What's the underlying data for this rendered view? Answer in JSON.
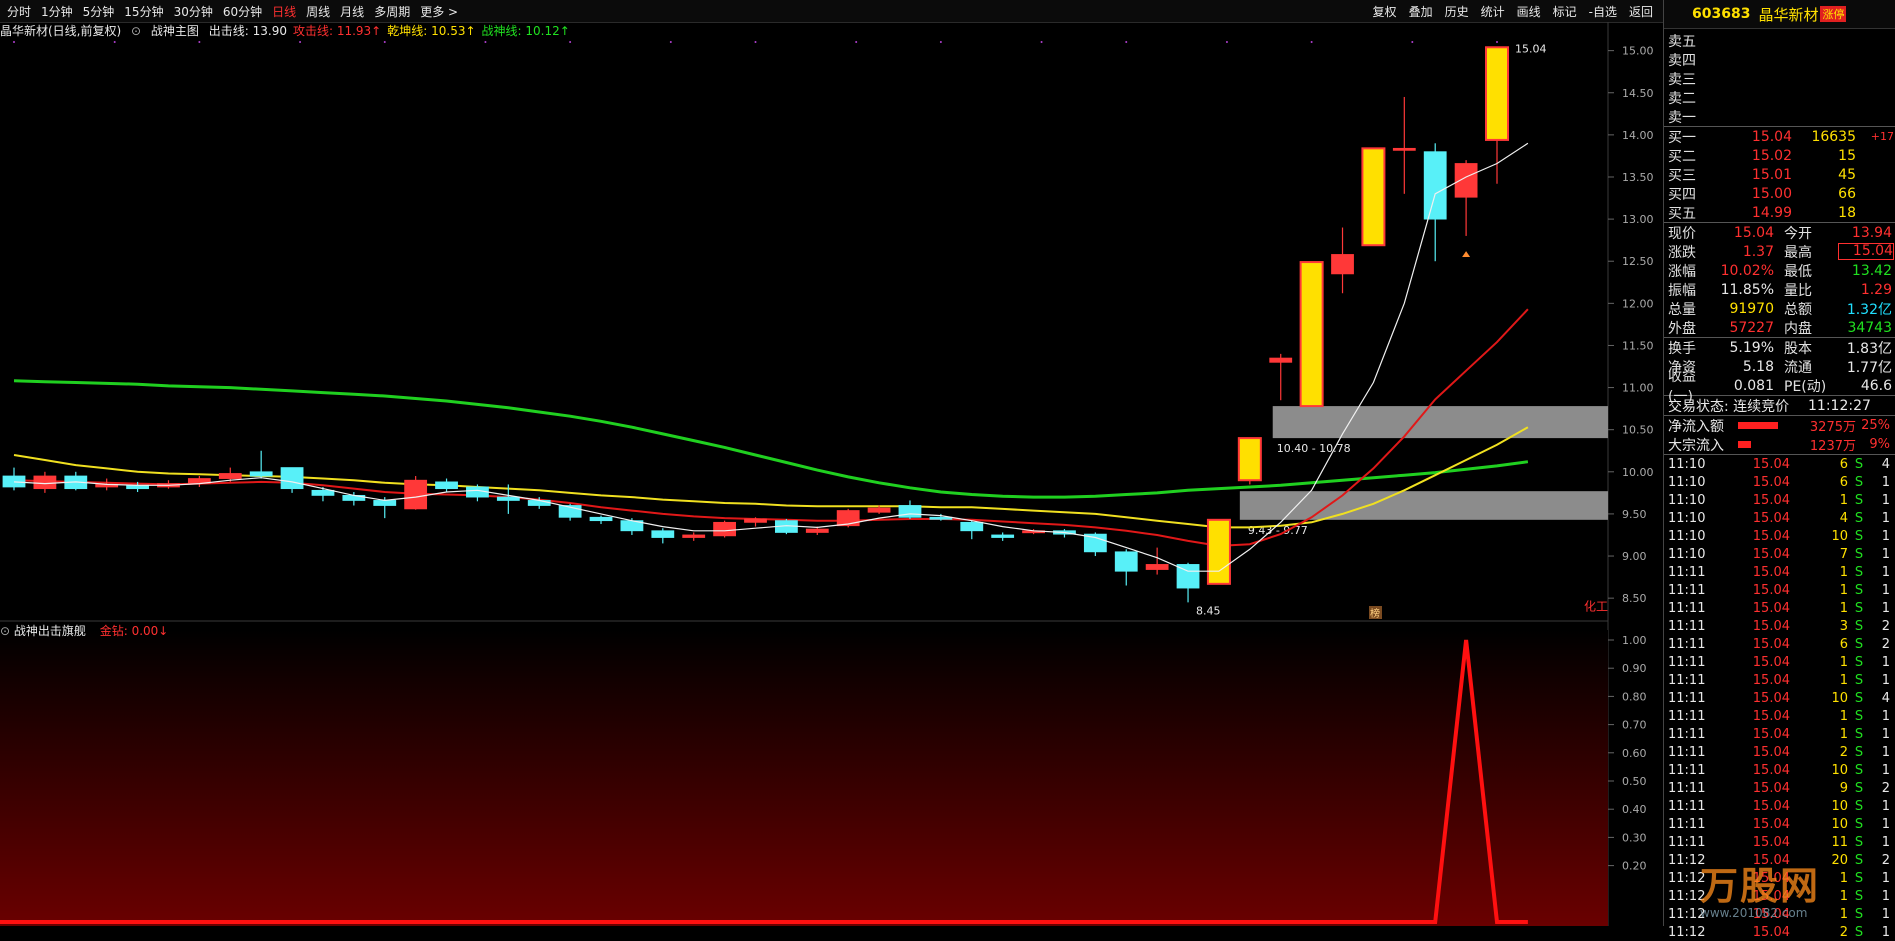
{
  "tabs": [
    "分时",
    "1分钟",
    "5分钟",
    "15分钟",
    "30分钟",
    "60分钟",
    "日线",
    "周线",
    "月线",
    "多周期",
    "更多 >"
  ],
  "active_tab": "日线",
  "toolbar": [
    "复权",
    "叠加",
    "历史",
    "统计",
    "画线",
    "标记",
    "-自选",
    "返回"
  ],
  "main_indicator": {
    "stock_label": "晶华新材(日线,前复权)",
    "indicator_name": "战神主图",
    "items": [
      {
        "label": "出击线: 13.90",
        "color": "#e8e8e8"
      },
      {
        "label": "攻击线: 11.93↑",
        "color": "#ff3030"
      },
      {
        "label": "乾坤线: 10.53↑",
        "color": "#ffe000"
      },
      {
        "label": "战神线: 10.12↑",
        "color": "#20e020"
      }
    ]
  },
  "sub_indicator": {
    "name": "战神出击旗舰",
    "items": [
      {
        "label": "金钻: 0.00↓",
        "color": "#ff3030"
      }
    ]
  },
  "price_axis": [
    "15.00",
    "14.50",
    "14.00",
    "13.50",
    "13.00",
    "12.50",
    "12.00",
    "11.50",
    "11.00",
    "10.50",
    "10.00",
    "9.50",
    "9.00",
    "8.50"
  ],
  "sub_axis": [
    "1.00",
    "0.90",
    "0.80",
    "0.70",
    "0.60",
    "0.50",
    "0.40",
    "0.30",
    "0.20"
  ],
  "chart_labels": {
    "high_label": "15.04",
    "low_label": "8.45",
    "zone_upper": "10.40 - 10.78",
    "zone_lower": "9.43 - 9.77",
    "side_tag": "化工",
    "marker_tag": "榜"
  },
  "chart_data": {
    "type": "candlestick",
    "ylim": [
      8.3,
      15.15
    ],
    "candles": [
      {
        "o": 9.95,
        "c": 9.82,
        "h": 10.05,
        "l": 9.78
      },
      {
        "o": 9.8,
        "c": 9.95,
        "h": 10.0,
        "l": 9.75
      },
      {
        "o": 9.95,
        "c": 9.8,
        "h": 10.0,
        "l": 9.78
      },
      {
        "o": 9.82,
        "c": 9.85,
        "h": 9.92,
        "l": 9.78
      },
      {
        "o": 9.84,
        "c": 9.8,
        "h": 9.88,
        "l": 9.76
      },
      {
        "o": 9.82,
        "c": 9.86,
        "h": 9.9,
        "l": 9.8
      },
      {
        "o": 9.86,
        "c": 9.92,
        "h": 9.95,
        "l": 9.82
      },
      {
        "o": 9.92,
        "c": 9.98,
        "h": 10.05,
        "l": 9.88
      },
      {
        "o": 10.0,
        "c": 9.95,
        "h": 10.25,
        "l": 9.92
      },
      {
        "o": 10.05,
        "c": 9.8,
        "h": 10.05,
        "l": 9.75
      },
      {
        "o": 9.78,
        "c": 9.72,
        "h": 9.82,
        "l": 9.65
      },
      {
        "o": 9.72,
        "c": 9.66,
        "h": 9.76,
        "l": 9.6
      },
      {
        "o": 9.66,
        "c": 9.6,
        "h": 9.7,
        "l": 9.45
      },
      {
        "o": 9.56,
        "c": 9.9,
        "h": 9.95,
        "l": 9.55
      },
      {
        "o": 9.88,
        "c": 9.8,
        "h": 9.92,
        "l": 9.76
      },
      {
        "o": 9.82,
        "c": 9.7,
        "h": 9.85,
        "l": 9.65
      },
      {
        "o": 9.7,
        "c": 9.66,
        "h": 9.85,
        "l": 9.5
      },
      {
        "o": 9.66,
        "c": 9.6,
        "h": 9.7,
        "l": 9.56
      },
      {
        "o": 9.6,
        "c": 9.46,
        "h": 9.62,
        "l": 9.42
      },
      {
        "o": 9.46,
        "c": 9.42,
        "h": 9.48,
        "l": 9.38
      },
      {
        "o": 9.42,
        "c": 9.3,
        "h": 9.45,
        "l": 9.25
      },
      {
        "o": 9.3,
        "c": 9.22,
        "h": 9.33,
        "l": 9.15
      },
      {
        "o": 9.22,
        "c": 9.25,
        "h": 9.28,
        "l": 9.18
      },
      {
        "o": 9.24,
        "c": 9.4,
        "h": 9.42,
        "l": 9.22
      },
      {
        "o": 9.4,
        "c": 9.44,
        "h": 9.46,
        "l": 9.35
      },
      {
        "o": 9.42,
        "c": 9.28,
        "h": 9.44,
        "l": 9.26
      },
      {
        "o": 9.28,
        "c": 9.32,
        "h": 9.35,
        "l": 9.25
      },
      {
        "o": 9.36,
        "c": 9.54,
        "h": 9.56,
        "l": 9.34
      },
      {
        "o": 9.52,
        "c": 9.57,
        "h": 9.6,
        "l": 9.5
      },
      {
        "o": 9.6,
        "c": 9.46,
        "h": 9.66,
        "l": 9.44
      },
      {
        "o": 9.46,
        "c": 9.44,
        "h": 9.5,
        "l": 9.42
      },
      {
        "o": 9.4,
        "c": 9.3,
        "h": 9.42,
        "l": 9.2
      },
      {
        "o": 9.25,
        "c": 9.22,
        "h": 9.28,
        "l": 9.18
      },
      {
        "o": 9.28,
        "c": 9.3,
        "h": 9.32,
        "l": 9.26
      },
      {
        "o": 9.3,
        "c": 9.26,
        "h": 9.32,
        "l": 9.22
      },
      {
        "o": 9.26,
        "c": 9.05,
        "h": 9.28,
        "l": 9.0
      },
      {
        "o": 9.05,
        "c": 8.82,
        "h": 9.08,
        "l": 8.65
      },
      {
        "o": 8.84,
        "c": 8.9,
        "h": 9.1,
        "l": 8.78
      },
      {
        "o": 8.9,
        "c": 8.62,
        "h": 8.92,
        "l": 8.45
      },
      {
        "o": 8.67,
        "c": 9.43,
        "h": 9.43,
        "l": 8.67
      },
      {
        "o": 9.9,
        "c": 10.4,
        "h": 10.4,
        "l": 9.85
      },
      {
        "o": 11.3,
        "c": 11.35,
        "h": 11.4,
        "l": 10.85
      },
      {
        "o": 10.78,
        "c": 12.49,
        "h": 12.49,
        "l": 10.78
      },
      {
        "o": 12.35,
        "c": 12.58,
        "h": 12.9,
        "l": 12.12
      },
      {
        "o": 12.69,
        "c": 13.84,
        "h": 13.84,
        "l": 12.69
      },
      {
        "o": 13.84,
        "c": 13.84,
        "h": 14.45,
        "l": 13.3
      },
      {
        "o": 13.8,
        "c": 13.0,
        "h": 13.9,
        "l": 12.5
      },
      {
        "o": 13.26,
        "c": 13.66,
        "h": 13.7,
        "l": 12.8
      },
      {
        "o": 13.94,
        "c": 15.04,
        "h": 15.04,
        "l": 13.42
      }
    ],
    "ma_white": [
      9.88,
      9.86,
      9.88,
      9.85,
      9.84,
      9.84,
      9.86,
      9.9,
      9.93,
      9.88,
      9.8,
      9.72,
      9.66,
      9.7,
      9.76,
      9.78,
      9.72,
      9.66,
      9.58,
      9.5,
      9.42,
      9.35,
      9.3,
      9.3,
      9.33,
      9.36,
      9.34,
      9.38,
      9.45,
      9.5,
      9.48,
      9.42,
      9.35,
      9.3,
      9.28,
      9.22,
      9.1,
      8.98,
      8.82,
      8.82,
      9.08,
      9.4,
      9.78,
      10.45,
      11.06,
      12.0,
      13.3,
      13.5,
      13.66,
      13.9
    ],
    "ma_red": [
      9.9,
      9.89,
      9.88,
      9.87,
      9.86,
      9.85,
      9.86,
      9.87,
      9.88,
      9.87,
      9.84,
      9.8,
      9.76,
      9.74,
      9.73,
      9.72,
      9.7,
      9.67,
      9.63,
      9.58,
      9.54,
      9.5,
      9.47,
      9.45,
      9.44,
      9.43,
      9.42,
      9.42,
      9.43,
      9.44,
      9.44,
      9.43,
      9.41,
      9.39,
      9.37,
      9.34,
      9.3,
      9.25,
      9.18,
      9.12,
      9.14,
      9.26,
      9.46,
      9.72,
      10.04,
      10.42,
      10.86,
      11.2,
      11.54,
      11.93
    ],
    "ma_yellow": [
      10.2,
      10.14,
      10.08,
      10.04,
      10.0,
      9.98,
      9.97,
      9.96,
      9.95,
      9.94,
      9.92,
      9.9,
      9.87,
      9.85,
      9.84,
      9.82,
      9.8,
      9.78,
      9.75,
      9.72,
      9.7,
      9.67,
      9.65,
      9.63,
      9.62,
      9.6,
      9.59,
      9.59,
      9.59,
      9.59,
      9.58,
      9.58,
      9.56,
      9.54,
      9.52,
      9.5,
      9.46,
      9.42,
      9.38,
      9.34,
      9.34,
      9.36,
      9.4,
      9.5,
      9.62,
      9.78,
      9.96,
      10.14,
      10.32,
      10.53
    ],
    "ma_green": [
      11.08,
      11.07,
      11.06,
      11.05,
      11.04,
      11.02,
      11.01,
      11.0,
      10.98,
      10.96,
      10.94,
      10.92,
      10.9,
      10.87,
      10.84,
      10.8,
      10.76,
      10.71,
      10.66,
      10.6,
      10.53,
      10.45,
      10.37,
      10.29,
      10.2,
      10.11,
      10.02,
      9.94,
      9.87,
      9.81,
      9.76,
      9.73,
      9.71,
      9.7,
      9.7,
      9.71,
      9.73,
      9.75,
      9.78,
      9.8,
      9.82,
      9.84,
      9.87,
      9.9,
      9.93,
      9.96,
      9.99,
      10.03,
      10.07,
      10.12
    ],
    "zones": [
      {
        "low": 10.4,
        "high": 10.78
      },
      {
        "low": 9.43,
        "high": 9.77
      }
    ],
    "sub_signal": [
      0,
      0,
      0,
      0,
      0,
      0,
      0,
      0,
      0,
      0,
      0,
      0,
      0,
      0,
      0,
      0,
      0,
      0,
      0,
      0,
      0,
      0,
      0,
      0,
      0,
      0,
      0,
      0,
      0,
      0,
      0,
      0,
      0,
      0,
      0,
      0,
      0,
      0,
      0,
      0,
      0,
      0,
      0,
      0,
      0,
      0,
      0,
      1,
      0,
      0
    ]
  },
  "quote": {
    "code": "603683",
    "name": "晶华新材",
    "badge": "涨停",
    "sells": [
      {
        "label": "卖五",
        "price": "",
        "vol": ""
      },
      {
        "label": "卖四",
        "price": "",
        "vol": ""
      },
      {
        "label": "卖三",
        "price": "",
        "vol": ""
      },
      {
        "label": "卖二",
        "price": "",
        "vol": ""
      },
      {
        "label": "卖一",
        "price": "",
        "vol": ""
      }
    ],
    "buys": [
      {
        "label": "买一",
        "price": "15.04",
        "vol": "16635",
        "chg": "+17"
      },
      {
        "label": "买二",
        "price": "15.02",
        "vol": "15",
        "chg": ""
      },
      {
        "label": "买三",
        "price": "15.01",
        "vol": "45",
        "chg": ""
      },
      {
        "label": "买四",
        "price": "15.00",
        "vol": "66",
        "chg": ""
      },
      {
        "label": "买五",
        "price": "14.99",
        "vol": "18",
        "chg": ""
      }
    ],
    "stats1": [
      {
        "l1": "现价",
        "v1": "15.04",
        "c1": "red",
        "l2": "今开",
        "v2": "13.94",
        "c2": "red"
      },
      {
        "l1": "涨跌",
        "v1": "1.37",
        "c1": "red",
        "l2": "最高",
        "v2": "15.04",
        "c2": "red"
      },
      {
        "l1": "涨幅",
        "v1": "10.02%",
        "c1": "red",
        "l2": "最低",
        "v2": "13.42",
        "c2": "green"
      },
      {
        "l1": "振幅",
        "v1": "11.85%",
        "c1": "white",
        "l2": "量比",
        "v2": "1.29",
        "c2": "red"
      },
      {
        "l1": "总量",
        "v1": "91970",
        "c1": "yellow",
        "l2": "总额",
        "v2": "1.32亿",
        "c2": "cyan"
      },
      {
        "l1": "外盘",
        "v1": "57227",
        "c1": "red",
        "l2": "内盘",
        "v2": "34743",
        "c2": "green"
      }
    ],
    "stats2": [
      {
        "l1": "换手",
        "v1": "5.19%",
        "c1": "white",
        "l2": "股本",
        "v2": "1.83亿",
        "c2": "white"
      },
      {
        "l1": "净资",
        "v1": "5.18",
        "c1": "white",
        "l2": "流通",
        "v2": "1.77亿",
        "c2": "white"
      },
      {
        "l1": "收益(一)",
        "v1": "0.081",
        "c1": "white",
        "l2": "PE(动)",
        "v2": "46.6",
        "c2": "white"
      }
    ],
    "status_label": "交易状态: 连续竞价",
    "status_time": "11:12:27",
    "flows": [
      {
        "label": "净流入额",
        "bar": 0.6,
        "value": "3275万",
        "pct": "25%"
      },
      {
        "label": "大宗流入",
        "bar": 0.2,
        "value": "1237万",
        "pct": "9%"
      }
    ],
    "trades": [
      {
        "t": "11:10",
        "p": "15.04",
        "v": "6",
        "s": "S",
        "n": "4"
      },
      {
        "t": "11:10",
        "p": "15.04",
        "v": "6",
        "s": "S",
        "n": "1"
      },
      {
        "t": "11:10",
        "p": "15.04",
        "v": "1",
        "s": "S",
        "n": "1"
      },
      {
        "t": "11:10",
        "p": "15.04",
        "v": "4",
        "s": "S",
        "n": "1"
      },
      {
        "t": "11:10",
        "p": "15.04",
        "v": "10",
        "s": "S",
        "n": "1"
      },
      {
        "t": "11:10",
        "p": "15.04",
        "v": "7",
        "s": "S",
        "n": "1"
      },
      {
        "t": "11:11",
        "p": "15.04",
        "v": "1",
        "s": "S",
        "n": "1"
      },
      {
        "t": "11:11",
        "p": "15.04",
        "v": "1",
        "s": "S",
        "n": "1"
      },
      {
        "t": "11:11",
        "p": "15.04",
        "v": "1",
        "s": "S",
        "n": "1"
      },
      {
        "t": "11:11",
        "p": "15.04",
        "v": "3",
        "s": "S",
        "n": "2"
      },
      {
        "t": "11:11",
        "p": "15.04",
        "v": "6",
        "s": "S",
        "n": "2"
      },
      {
        "t": "11:11",
        "p": "15.04",
        "v": "1",
        "s": "S",
        "n": "1"
      },
      {
        "t": "11:11",
        "p": "15.04",
        "v": "1",
        "s": "S",
        "n": "1"
      },
      {
        "t": "11:11",
        "p": "15.04",
        "v": "10",
        "s": "S",
        "n": "4"
      },
      {
        "t": "11:11",
        "p": "15.04",
        "v": "1",
        "s": "S",
        "n": "1"
      },
      {
        "t": "11:11",
        "p": "15.04",
        "v": "1",
        "s": "S",
        "n": "1"
      },
      {
        "t": "11:11",
        "p": "15.04",
        "v": "2",
        "s": "S",
        "n": "1"
      },
      {
        "t": "11:11",
        "p": "15.04",
        "v": "10",
        "s": "S",
        "n": "1"
      },
      {
        "t": "11:11",
        "p": "15.04",
        "v": "9",
        "s": "S",
        "n": "2"
      },
      {
        "t": "11:11",
        "p": "15.04",
        "v": "10",
        "s": "S",
        "n": "1"
      },
      {
        "t": "11:11",
        "p": "15.04",
        "v": "10",
        "s": "S",
        "n": "1"
      },
      {
        "t": "11:11",
        "p": "15.04",
        "v": "11",
        "s": "S",
        "n": "1"
      },
      {
        "t": "11:12",
        "p": "15.04",
        "v": "20",
        "s": "S",
        "n": "2"
      },
      {
        "t": "11:12",
        "p": "15.04",
        "v": "1",
        "s": "S",
        "n": "1"
      },
      {
        "t": "11:12",
        "p": "15.04",
        "v": "1",
        "s": "S",
        "n": "1"
      },
      {
        "t": "11:12",
        "p": "15.04",
        "v": "1",
        "s": "S",
        "n": "1"
      },
      {
        "t": "11:12",
        "p": "15.04",
        "v": "2",
        "s": "S",
        "n": "1"
      }
    ]
  },
  "watermark": {
    "brand": "万股网",
    "url": "www.201082.com"
  },
  "colors": {
    "up": "#ff3030",
    "down": "#50f0f8",
    "limit": "#ffe000",
    "zone": "#9a9a9a"
  }
}
